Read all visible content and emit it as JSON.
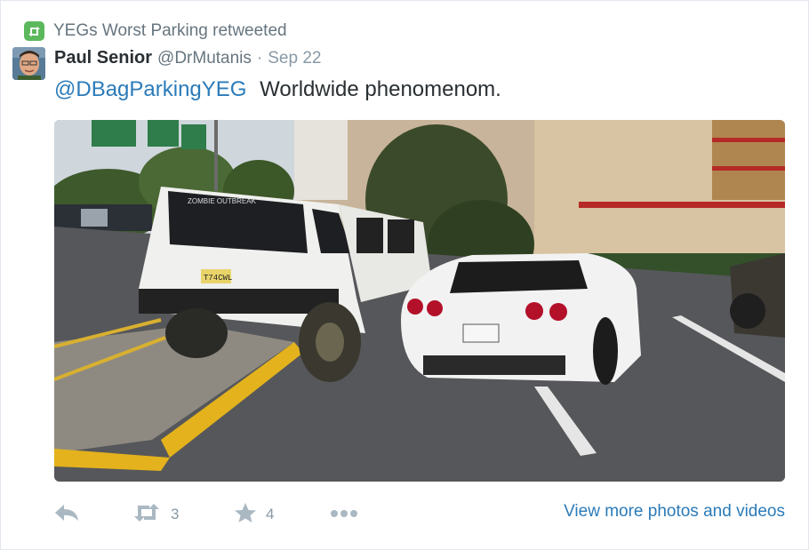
{
  "context": {
    "text": "YEGs Worst Parking retweeted",
    "icon": "retweet-icon"
  },
  "tweet": {
    "fullname": "Paul Senior",
    "username": "@DrMutanis",
    "separator": "·",
    "time": "Sep 22",
    "mention": "@DBagParkingYEG",
    "text": "Worldwide phenomenom."
  },
  "photo": {
    "plate_jeep": "T74CWL",
    "sign_left": "",
    "sign_mid": "",
    "sign_right": "",
    "decal_jeep": "ZOMBIE OUTBREAK"
  },
  "actions": {
    "reply_icon": "reply-icon",
    "retweet_icon": "retweet-icon",
    "retweet_count": "3",
    "favorite_icon": "star-icon",
    "favorite_count": "4",
    "more_icon": "more-dots-icon",
    "view_more": "View more photos and videos"
  },
  "colors": {
    "accent": "#2b7bb9",
    "retweet_green": "#5cb85c",
    "action_gray": "#aab8c2"
  }
}
